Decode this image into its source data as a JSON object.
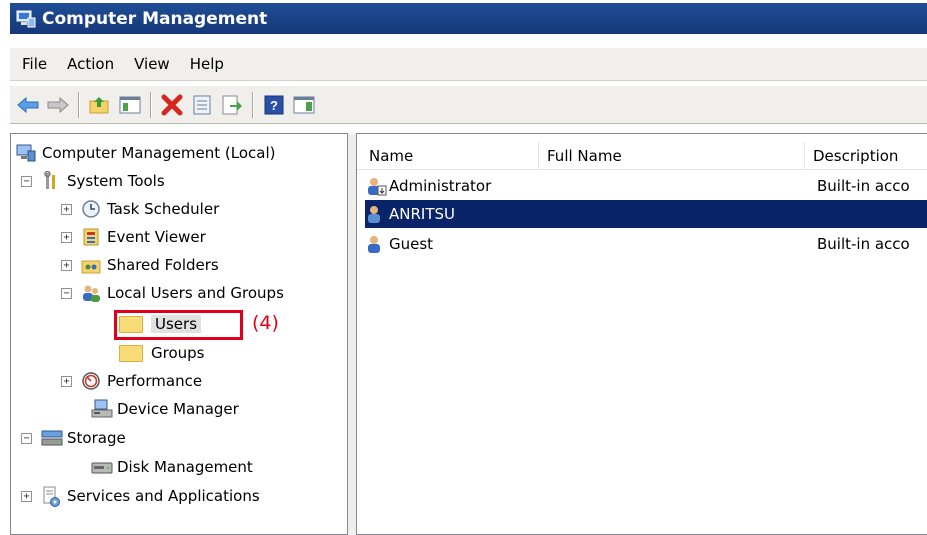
{
  "window": {
    "title": "Computer Management"
  },
  "menu": {
    "items": [
      "File",
      "Action",
      "View",
      "Help"
    ]
  },
  "toolbar": {
    "buttons": [
      "back-icon",
      "forward-icon",
      "up-folder-icon",
      "show-hide-tree-icon",
      "delete-icon",
      "properties-icon",
      "export-icon",
      "help-icon",
      "action-pane-icon"
    ]
  },
  "tree": {
    "root": "Computer Management (Local)",
    "system_tools": "System Tools",
    "task_scheduler": "Task Scheduler",
    "event_viewer": "Event Viewer",
    "shared_folders": "Shared Folders",
    "local_users": "Local Users and Groups",
    "users": "Users",
    "groups": "Groups",
    "performance": "Performance",
    "device_manager": "Device Manager",
    "storage": "Storage",
    "disk_management": "Disk Management",
    "services": "Services and Applications",
    "expand_plus": "+",
    "collapse_minus": "−"
  },
  "annotation": {
    "label": "(4)",
    "color": "#e0001b"
  },
  "list": {
    "columns": [
      "Name",
      "Full Name",
      "Description"
    ],
    "rows": [
      {
        "name": "Administrator",
        "full_name": "",
        "description": "Built-in acco"
      },
      {
        "name": "ANRITSU",
        "full_name": "",
        "description": ""
      },
      {
        "name": "Guest",
        "full_name": "",
        "description": "Built-in acco"
      }
    ],
    "selected_color": "#0a246a"
  }
}
